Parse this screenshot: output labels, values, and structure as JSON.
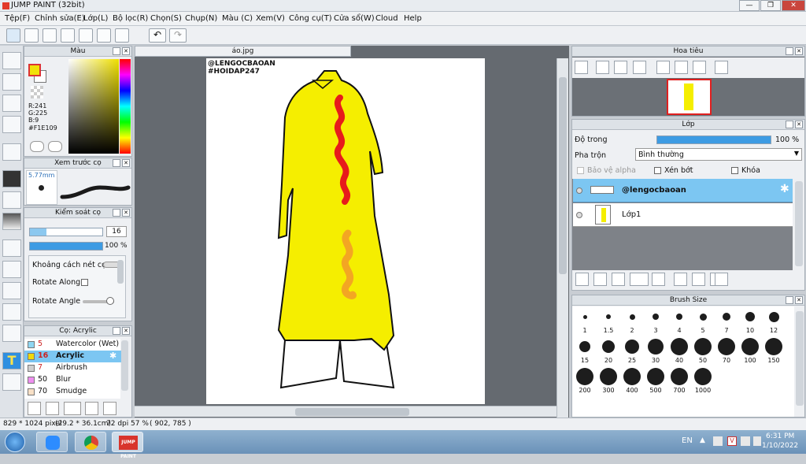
{
  "window": {
    "title": "JUMP PAINT (32bit)",
    "min": "—",
    "max": "❐",
    "close": "✕"
  },
  "menu": [
    "Tệp(F)",
    "Chỉnh sửa(E)",
    "Lớp(L)",
    "Bộ lọc(R)",
    "Chọn(S)",
    "Chụp(N)",
    "Màu (C)",
    "Xem(V)",
    "Công cụ(T)",
    "Cửa sổ(W)",
    "Cloud",
    "Help"
  ],
  "color_panel": {
    "title": "Màu",
    "r": "R:241",
    "g": "G:225",
    "b": "B:9",
    "hex": "#F1E109",
    "main_color": "#F1E109"
  },
  "brush_preview": {
    "title": "Xem trước cọ",
    "size": "5.77mm"
  },
  "brush_control": {
    "title": "Kiểm soát cọ",
    "size_value": "16",
    "opacity_value": "100 %",
    "spacing_label": "Khoảng cách nét cọ",
    "rotate_along": "Rotate Along",
    "rotate_angle": "Rotate Angle",
    "size_fill": 0.23,
    "opacity_fill": 1.0
  },
  "brush_list": {
    "title": "Cọ: Acrylic",
    "items": [
      {
        "num": "5",
        "name": "Watercolor (Wet)",
        "color": "#8fd6f2",
        "selected": false
      },
      {
        "num": "16",
        "name": "Acrylic",
        "color": "#f1d80a",
        "selected": true
      },
      {
        "num": "7",
        "name": "Airbrush",
        "color": "#cfcfcf",
        "selected": false
      },
      {
        "num": "50",
        "name": "Blur",
        "color": "#ef8ff0",
        "selected": false
      },
      {
        "num": "70",
        "name": "Smudge",
        "color": "#f8e0c6",
        "selected": false
      }
    ]
  },
  "document": {
    "tab": "áo.jpg",
    "watermark1": "@LENGOCBAOAN",
    "watermark2": "#HOIDAP247"
  },
  "navigator": {
    "title": "Hoa tiêu"
  },
  "layer_panel": {
    "title": "Lớp",
    "opacity_label": "Độ trong",
    "opacity_value": "100 %",
    "opacity_fill": 1.0,
    "blend_label": "Pha trộn",
    "blend_value": "Bình thường",
    "protect_alpha": "Bảo vệ alpha",
    "clipping": "Xén bớt",
    "lock": "Khóa",
    "layers": [
      {
        "name": "@lengocbaoan",
        "selected": true
      },
      {
        "name": "Lớp1",
        "selected": false
      }
    ]
  },
  "brush_size": {
    "title": "Brush Size",
    "sizes": [
      "1",
      "1.5",
      "2",
      "3",
      "4",
      "5",
      "7",
      "10",
      "12",
      "15",
      "20",
      "25",
      "30",
      "40",
      "50",
      "70",
      "100",
      "150",
      "200",
      "300",
      "400",
      "500",
      "700",
      "1000"
    ]
  },
  "status": {
    "dims": "829 * 1024 pixel",
    "cm": "(29.2 * 36.1cm)",
    "dpi": "72 dpi",
    "zoom": "57 %",
    "coords": "( 902, 785 )"
  },
  "taskbar": {
    "lang": "EN",
    "time": "6:31 PM",
    "date": "1/10/2022",
    "app_label": "JUMP PAINT"
  }
}
